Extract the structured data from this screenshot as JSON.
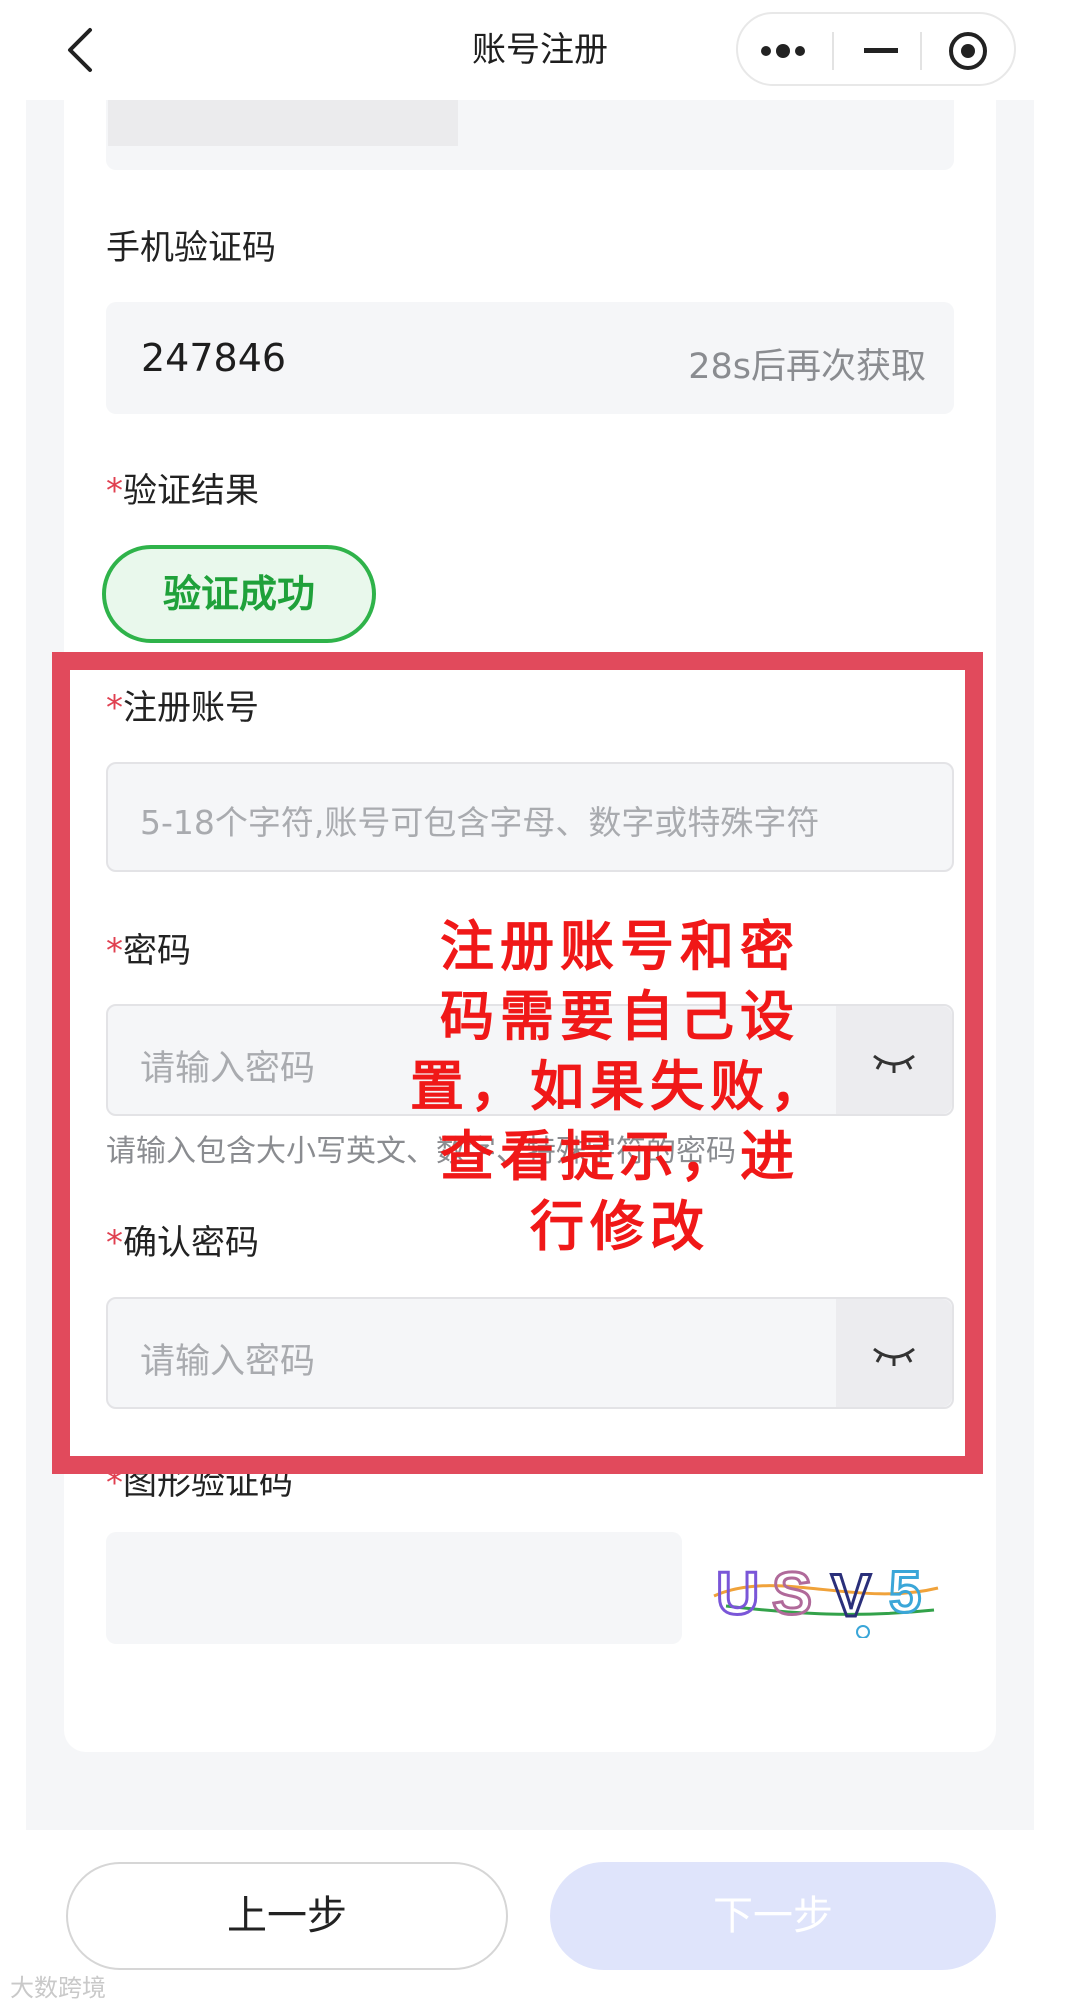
{
  "header": {
    "title": "账号注册",
    "back_icon": "chevron-left-icon",
    "more_icon": "more-dots-icon",
    "minimize_icon": "minus-icon",
    "close_icon": "target-circle-icon"
  },
  "sms_code": {
    "label": "手机验证码",
    "value": "247846",
    "resend_text": "28s后再次获取"
  },
  "verify_result": {
    "required_mark": "*",
    "label": "验证结果",
    "status": "验证成功"
  },
  "account": {
    "required_mark": "*",
    "label": "注册账号",
    "placeholder": "5-18个字符,账号可包含字母、数字或特殊字符"
  },
  "password": {
    "required_mark": "*",
    "label": "密码",
    "placeholder": "请输入密码",
    "hint": "请输入包含大小写英文、数字、特殊字符的密码",
    "eye_icon": "eye-closed-icon"
  },
  "confirm_password": {
    "required_mark": "*",
    "label": "确认密码",
    "placeholder": "请输入密码",
    "eye_icon": "eye-closed-icon"
  },
  "captcha": {
    "required_mark": "*",
    "label": "图形验证码",
    "value": "",
    "image_text": "USV5"
  },
  "annotation": {
    "text": "注册账号和密码需要自己设置，如果失败，查看提示，进行修改",
    "lines": [
      "注册账号和密",
      "码需要自己设",
      "置，如果失败，",
      "查看提示，进",
      "行修改"
    ],
    "color": "#f01818"
  },
  "footer": {
    "prev_label": "上一步",
    "next_label": "下一步"
  },
  "watermark": "大数跨境",
  "colors": {
    "accent_green": "#2fb34a",
    "annotation_red": "#e14a5c",
    "next_disabled": "#dfe4fb"
  }
}
